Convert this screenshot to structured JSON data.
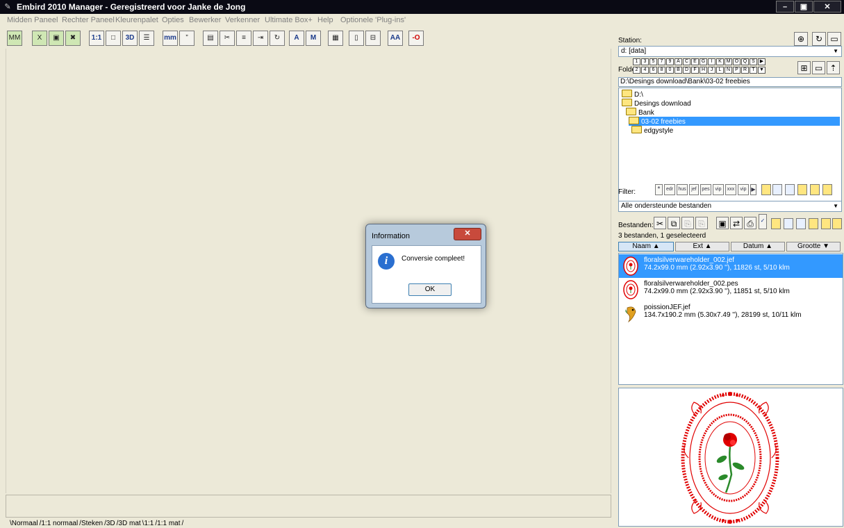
{
  "window": {
    "title": "Embird 2010 Manager - Geregistreerd voor Janke de Jong"
  },
  "menu": [
    "Midden Paneel",
    "Rechter Paneel",
    "Kleurenpalet",
    "Opties",
    "Bewerker",
    "Verkenner",
    "Ultimate Box+",
    "Help",
    "Optionele 'Plug-ins'"
  ],
  "toolbar": [
    "MM",
    "X",
    "▣",
    "✖",
    "1:1",
    "□",
    "3D",
    "☰",
    "mm",
    "”",
    "▤",
    "✂",
    "≡",
    "⇥",
    "↻",
    "A",
    "M",
    "▦",
    "▯",
    "⊟",
    "AA",
    "-O"
  ],
  "station": {
    "label": "Station:",
    "drive": "d: [data]",
    "folder_label": "Folder:",
    "keys_top": [
      "1",
      "3",
      "5",
      "7",
      "9",
      "A",
      "C",
      "E",
      "G",
      "I",
      "K",
      "M",
      "O",
      "Q",
      "S",
      "▶"
    ],
    "keys_bottom": [
      "2",
      "4",
      "6",
      "8",
      "0",
      "B",
      "D",
      "F",
      "H",
      "J",
      "L",
      "N",
      "P",
      "R",
      "T",
      "▼"
    ],
    "path": "D:\\Desings download\\Bank\\03-02 freebies"
  },
  "tree": [
    {
      "label": "D:\\",
      "indent": 0,
      "selected": false
    },
    {
      "label": "Desings download",
      "indent": 1,
      "selected": false
    },
    {
      "label": "Bank",
      "indent": 1,
      "selected": false
    },
    {
      "label": "03-02 freebies",
      "indent": 2,
      "selected": true
    },
    {
      "label": "edgystyle",
      "indent": 2,
      "selected": false
    }
  ],
  "filter": {
    "label": "Filter:",
    "buttons": [
      "*",
      "edr",
      "hus",
      "jef",
      "pes",
      "vip",
      "xxx",
      "vip",
      "▶"
    ],
    "selected": "Alle ondersteunde bestanden"
  },
  "files": {
    "label": "Bestanden:",
    "status": "3 bestanden, 1 geselecteerd",
    "columns": [
      "Naam ▲",
      "Ext ▲",
      "Datum ▲",
      "Grootte ▼"
    ],
    "rows": [
      {
        "name": "floralsilverwareholder_002.jef",
        "info": "74.2x99.0 mm (2.92x3.90 ''), 11826 st, 5/10 klm",
        "selected": true
      },
      {
        "name": "floralsilverwareholder_002.pes",
        "info": "74.2x99.0 mm (2.92x3.90 ''), 11851 st, 5/10 klm",
        "selected": false
      },
      {
        "name": "poissionJEF.jef",
        "info": "134.7x190.2 mm (5.30x7.49 ''), 28199 st, 10/11 klm",
        "selected": false
      }
    ]
  },
  "tabs": [
    "\\Normaal",
    "/1:1 normaal",
    "/Steken",
    "/3D",
    "/3D mat",
    "\\1:1",
    "/1:1 mat",
    "/"
  ],
  "dialog": {
    "title": "Information",
    "message": "Conversie compleet!",
    "ok": "OK"
  },
  "colors": {
    "selection": "#3399ff",
    "accent_red": "#e00000",
    "titlebar": "#0a0a14"
  }
}
